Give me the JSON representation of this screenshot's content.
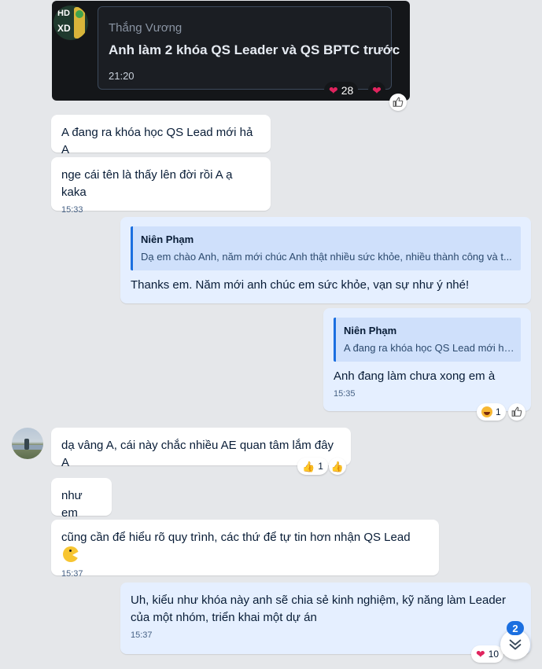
{
  "forward_card": {
    "logo_text_top": "HD",
    "logo_text_mid": "XD",
    "sender": "Thắng Vương",
    "message": "Anh làm 2 khóa QS Leader và QS BPTC trước",
    "time": "21:20",
    "heart_count": "28"
  },
  "messages": {
    "m1": {
      "text": "A đang ra khóa học QS Lead mới hả A"
    },
    "m2": {
      "text": "nge cái tên là thấy lên đời rồi A ạ kaka",
      "time": "15:33"
    },
    "m3": {
      "quote_name": "Niên Phạm",
      "quote_text": "Dạ em chào Anh, năm mới chúc Anh thật nhiều sức khỏe, nhiều thành công và t...",
      "text": "Thanks em. Năm mới anh chúc em sức khỏe, vạn sự như ý nhé!"
    },
    "m4": {
      "quote_name": "Niên Phạm",
      "quote_text": "A đang ra khóa học QS Lead mới hả A",
      "text": "Anh đang làm chưa xong em à",
      "time": "15:35",
      "react_count": "1"
    },
    "m5": {
      "text": "dạ vâng A, cái này chắc nhiều AE quan tâm lắm đây A",
      "react_count": "1"
    },
    "m6": {
      "text": "như em"
    },
    "m7": {
      "text": "cũng cần để hiểu rõ quy trình, các thứ để tự tin hơn nhận QS Lead",
      "time": "15:37"
    },
    "m8": {
      "text_line1": "Uh, kiểu như khóa này anh sẽ chia sẻ kinh nghiệm, kỹ năng làm Leader",
      "text_line2": "của một nhóm, triển khai một dự án",
      "time": "15:37",
      "heart_count": "10"
    }
  },
  "scroll_badge": {
    "count": "2"
  },
  "colors": {
    "accent": "#1b6fe0",
    "heart": "#e0245e",
    "my_bubble": "#e5efff"
  }
}
